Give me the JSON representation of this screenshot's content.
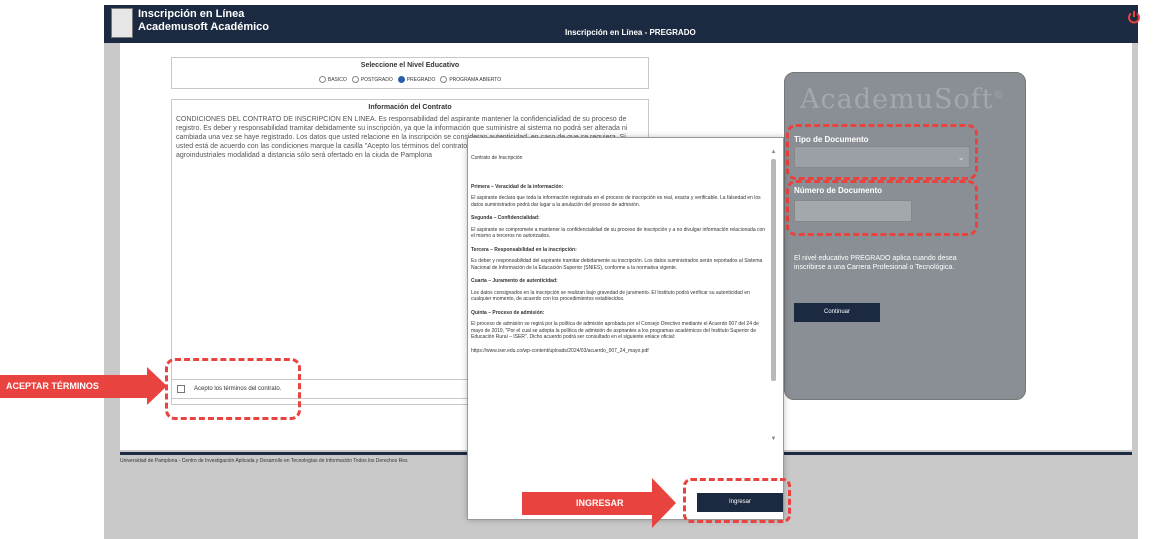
{
  "header": {
    "app_title": "Inscripción en Línea",
    "app_subtitle": "Academusoft Académico",
    "center_title": "Inscripción en Línea - PREGRADO"
  },
  "level": {
    "title": "Seleccione el Nivel Educativo",
    "options": [
      "BASICO",
      "POSTGRADO",
      "PREGRADO",
      "PROGRAMA ABIERTO"
    ],
    "selected": "PREGRADO"
  },
  "contract": {
    "title": "Información del Contrato",
    "text": "CONDICIONES DEL CONTRATO DE INSCRIPCION EN LINEA. Es responsabilidad del aspirante mantener la confidencialidad de su proceso de registro. Es deber y responsabilidad tramitar debidamente su inscripción, ya que la información que suministre al sistema no podrá ser alterada ni cambiada una vez se haye registrado. Los datos que usted relacione en la inscripción se consideran autenticidad, en caso de que se requiera. Si usted está de acuerdo con las condiciones marque la casilla \"Acepto los términos del contrato\" para comenzar el registro de su in procesos agroindustriales modalidad a distancia sólo será ofertado en la ciuda de Pamplona",
    "accept_label": "Acepto los términos del contrato."
  },
  "login": {
    "brand": "AcademuSoft",
    "brand_mark": "©",
    "doc_type_label": "Tipo de Documento",
    "doc_number_label": "Número de Documento",
    "info": "El nivel educativo PREGRADO aplica cuando desea inscribirse a una Carrera Profesional o Tecnológica.",
    "continue_label": "Continuar"
  },
  "footer": {
    "text": "Universidad de Pamplona - Centro de Investigación Aplicada y Desarrollo en Tecnologías de Información Todos los Derechos Res"
  },
  "modal": {
    "heading": "Contrato de Inscripción",
    "sections": [
      {
        "title": "Primera – Veracidad de la información:",
        "body": "El aspirante declara que toda la información registrada en el proceso de inscripción es real, exacta y verificable. La falsedad en los datos suministrados podrá dar lugar a la anulación del proceso de admisión."
      },
      {
        "title": "Segunda – Confidencialidad:",
        "body": "El aspirante se compromete a mantener la confidencialidad de su proceso de inscripción y a no divulgar información relacionada con el mismo a terceros no autorizados."
      },
      {
        "title": "Tercera – Responsabilidad en la inscripción:",
        "body": "Es deber y responsabilidad del aspirante tramitar debidamente su inscripción. Los datos suministrados serán reportados al Sistema Nacional de Información de la Educación Superior (SNIES), conforme a la normativa vigente."
      },
      {
        "title": "Cuarta – Juramento de autenticidad:",
        "body": "Los datos consignados en la inscripción se realizan bajo gravedad de juramento. El Instituto podrá verificar su autenticidad en cualquier momento, de acuerdo con los procedimientos establecidos."
      },
      {
        "title": "Quinta – Proceso de admisión:",
        "body": "El proceso de admisión se regirá por la política de admisión aprobada por el Consejo Directivo mediante el Acuerdo 007 del 24 de mayo de 2019, \"Por el cual se adopta la política de admisión de aspirantes a los programas académicos del Instituto Superior de Educación Rural – ISER\". Dicho acuerdo podrá ser consultado en el siguiente enlace oficial:"
      }
    ],
    "link": "https://www.iser.edu.co/wp-content/uploads/2024/03/acuerdo_007_24_mayo.pdf",
    "ingresar_label": "Ingresar"
  },
  "callouts": {
    "accept": "ACEPTAR TÉRMINOS",
    "ingresar": "INGRESAR"
  }
}
